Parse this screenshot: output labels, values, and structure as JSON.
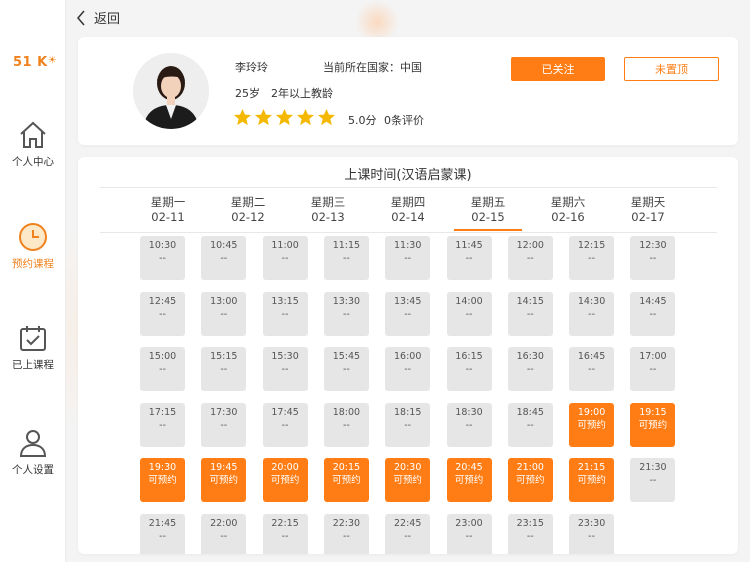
{
  "nav": {
    "back_label": "返回",
    "logo_text": "51 K",
    "items": [
      {
        "label": "个人中心",
        "icon": "home-icon",
        "active": false
      },
      {
        "label": "预约课程",
        "icon": "clock-icon",
        "active": true
      },
      {
        "label": "已上课程",
        "icon": "calendar-check-icon",
        "active": false
      },
      {
        "label": "个人设置",
        "icon": "user-icon",
        "active": false
      }
    ]
  },
  "teacher": {
    "name": "李玲玲",
    "country": "当前所在国家：中国",
    "age": "25岁",
    "experience": "2年以上教龄",
    "rating_stars": 5,
    "score": "5.0分",
    "reviews": "0条评价",
    "follow_label": "已关注",
    "pin_label": "未置顶"
  },
  "colors": {
    "accent": "#ff7d14",
    "slot_bg": "#e6e6e6",
    "star": "#f5b800"
  },
  "schedule": {
    "title": "上课时间(汉语启蒙课)",
    "selected_day": 4,
    "days": [
      {
        "weekday": "星期一",
        "date": "02-11"
      },
      {
        "weekday": "星期二",
        "date": "02-12"
      },
      {
        "weekday": "星期三",
        "date": "02-13"
      },
      {
        "weekday": "星期四",
        "date": "02-14"
      },
      {
        "weekday": "星期五",
        "date": "02-15"
      },
      {
        "weekday": "星期六",
        "date": "02-16"
      },
      {
        "weekday": "星期天",
        "date": "02-17"
      }
    ],
    "slots": [
      {
        "time": "10:30",
        "status": "--"
      },
      {
        "time": "10:45",
        "status": "--"
      },
      {
        "time": "11:00",
        "status": "--"
      },
      {
        "time": "11:15",
        "status": "--"
      },
      {
        "time": "11:30",
        "status": "--"
      },
      {
        "time": "11:45",
        "status": "--"
      },
      {
        "time": "12:00",
        "status": "--"
      },
      {
        "time": "12:15",
        "status": "--"
      },
      {
        "time": "12:30",
        "status": "--"
      },
      {
        "time": "12:45",
        "status": "--"
      },
      {
        "time": "13:00",
        "status": "--"
      },
      {
        "time": "13:15",
        "status": "--"
      },
      {
        "time": "13:30",
        "status": "--"
      },
      {
        "time": "13:45",
        "status": "--"
      },
      {
        "time": "14:00",
        "status": "--"
      },
      {
        "time": "14:15",
        "status": "--"
      },
      {
        "time": "14:30",
        "status": "--"
      },
      {
        "time": "14:45",
        "status": "--"
      },
      {
        "time": "15:00",
        "status": "--"
      },
      {
        "time": "15:15",
        "status": "--"
      },
      {
        "time": "15:30",
        "status": "--"
      },
      {
        "time": "15:45",
        "status": "--"
      },
      {
        "time": "16:00",
        "status": "--"
      },
      {
        "time": "16:15",
        "status": "--"
      },
      {
        "time": "16:30",
        "status": "--"
      },
      {
        "time": "16:45",
        "status": "--"
      },
      {
        "time": "17:00",
        "status": "--"
      },
      {
        "time": "17:15",
        "status": "--"
      },
      {
        "time": "17:30",
        "status": "--"
      },
      {
        "time": "17:45",
        "status": "--"
      },
      {
        "time": "18:00",
        "status": "--"
      },
      {
        "time": "18:15",
        "status": "--"
      },
      {
        "time": "18:30",
        "status": "--"
      },
      {
        "time": "18:45",
        "status": "--"
      },
      {
        "time": "19:00",
        "status": "可预约"
      },
      {
        "time": "19:15",
        "status": "可预约"
      },
      {
        "time": "19:30",
        "status": "可预约"
      },
      {
        "time": "19:45",
        "status": "可预约"
      },
      {
        "time": "20:00",
        "status": "可预约"
      },
      {
        "time": "20:15",
        "status": "可预约"
      },
      {
        "time": "20:30",
        "status": "可预约"
      },
      {
        "time": "20:45",
        "status": "可预约"
      },
      {
        "time": "21:00",
        "status": "可预约"
      },
      {
        "time": "21:15",
        "status": "可预约"
      },
      {
        "time": "21:30",
        "status": "--"
      },
      {
        "time": "21:45",
        "status": "--"
      },
      {
        "time": "22:00",
        "status": "--"
      },
      {
        "time": "22:15",
        "status": "--"
      },
      {
        "time": "22:30",
        "status": "--"
      },
      {
        "time": "22:45",
        "status": "--"
      },
      {
        "time": "23:00",
        "status": "--"
      },
      {
        "time": "23:15",
        "status": "--"
      },
      {
        "time": "23:30",
        "status": "--"
      }
    ]
  }
}
